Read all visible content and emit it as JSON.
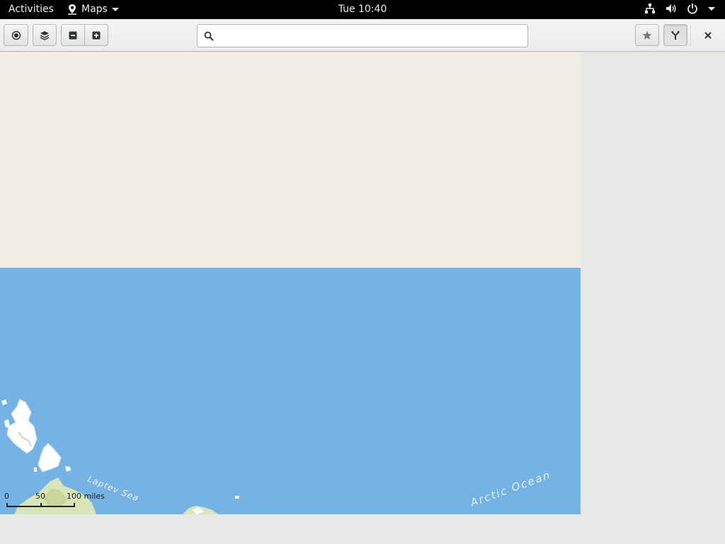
{
  "topbar": {
    "activities": "Activities",
    "app_name": "Maps",
    "clock": "Tue 10:40",
    "icons": [
      "network-icon",
      "volume-icon",
      "power-icon"
    ]
  },
  "toolbar": {
    "icons": {
      "locate": "location-target-icon",
      "layers": "layers-icon",
      "zoom_out": "zoom-out-icon",
      "zoom_in": "zoom-in-icon",
      "search": "search-icon",
      "favorites": "star-icon",
      "route": "route-icon",
      "close": "close-icon"
    }
  },
  "search": {
    "value": "",
    "placeholder": ""
  },
  "map": {
    "labels": {
      "sea": "Laptev Sea",
      "ocean": "Arctic Ocean"
    },
    "scale": {
      "zero": "0",
      "mid": "50",
      "max": "100 miles"
    },
    "colors": {
      "land": "#f1eee8",
      "water": "#74b3e4",
      "ice": "#ffffff",
      "terrain": "#cfe0b0"
    }
  }
}
